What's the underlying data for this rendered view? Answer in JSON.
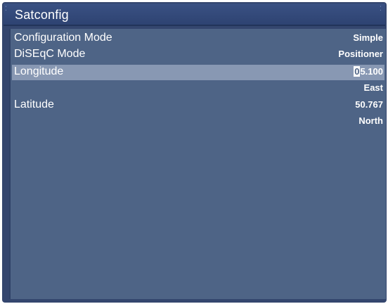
{
  "window": {
    "title": "Satconfig"
  },
  "settings": [
    {
      "label": "Configuration Mode",
      "value": "Simple"
    },
    {
      "label": "DiSEqC Mode",
      "value": "Positioner"
    },
    {
      "label": "Longitude",
      "value_cursor": "0",
      "value_rest": "5.100",
      "sub_value": "East"
    },
    {
      "label": "Latitude",
      "value": "50.767",
      "sub_value": "North"
    }
  ],
  "icons": {
    "corner_screw": "screw-icon"
  },
  "colors": {
    "frame": "#34466e",
    "panel": "#4e6486",
    "selection": "#8898b3",
    "text": "#ffffff"
  }
}
